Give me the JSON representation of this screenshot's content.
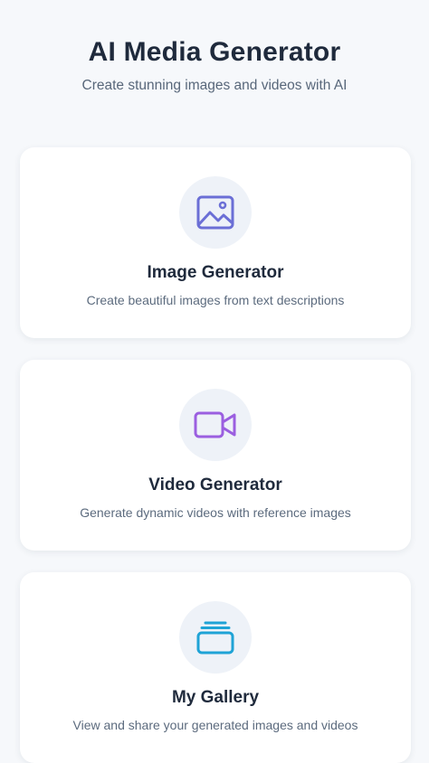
{
  "header": {
    "title": "AI Media Generator",
    "subtitle": "Create stunning images and videos with AI"
  },
  "cards": [
    {
      "title": "Image Generator",
      "description": "Create beautiful images from text descriptions",
      "icon": "image-icon",
      "icon_color": "#6b6fd6"
    },
    {
      "title": "Video Generator",
      "description": "Generate dynamic videos with reference images",
      "icon": "video-camera-icon",
      "icon_color": "#9b5fe0"
    },
    {
      "title": "My Gallery",
      "description": "View and share your generated images and videos",
      "icon": "gallery-icon",
      "icon_color": "#1fa3d6"
    }
  ],
  "colors": {
    "background": "#f6f8fb",
    "card": "#ffffff",
    "icon_circle": "#eef2f8",
    "title_text": "#1f2a3c",
    "body_text": "#5c6b7e"
  }
}
